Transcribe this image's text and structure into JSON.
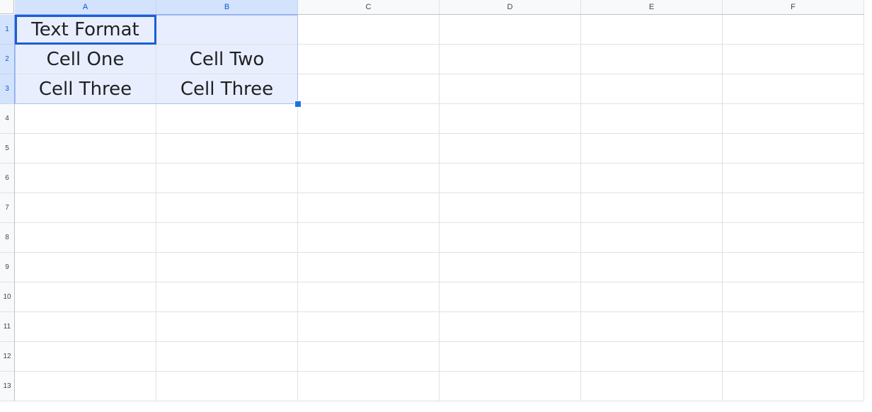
{
  "columns": [
    "A",
    "B",
    "C",
    "D",
    "E",
    "F"
  ],
  "rows": [
    "1",
    "2",
    "3",
    "4",
    "5",
    "6",
    "7",
    "8",
    "9",
    "10",
    "11",
    "12",
    "13"
  ],
  "cells": {
    "A1": "Text Format",
    "B1": "",
    "A2": "Cell One",
    "B2": "Cell Two",
    "A3": "Cell Three",
    "B3": "Cell Three"
  },
  "selection": {
    "active_cell": "A1",
    "range": "A1:B3"
  },
  "colors": {
    "selection_border": "#1a5fd6",
    "selection_fill": "#e8eefd",
    "header_selected_bg": "#d3e3fd"
  }
}
